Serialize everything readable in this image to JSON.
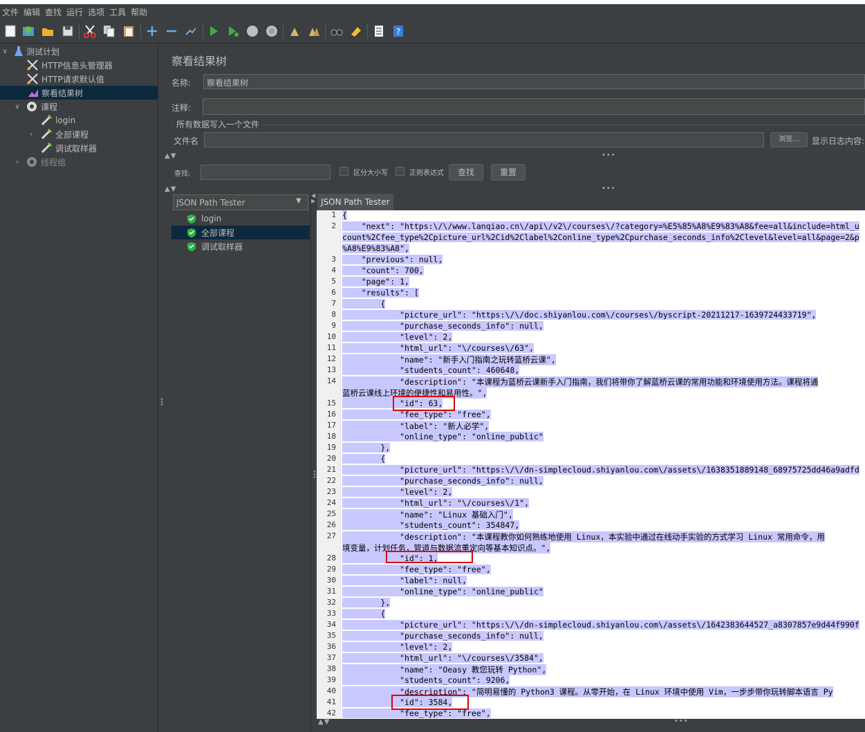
{
  "menu": [
    "文件",
    "编辑",
    "查找",
    "运行",
    "选项",
    "工具",
    "帮助"
  ],
  "toolbar": {
    "icons": [
      "new-icon",
      "templates-icon",
      "open-icon",
      "save-icon",
      "cut-icon",
      "copy-icon",
      "paste-icon",
      "expand-icon",
      "collapse-icon",
      "toggle-icon",
      "start-icon",
      "start-no-pause-icon",
      "stop-icon",
      "shutdown-icon",
      "clear-icon",
      "clear-all-icon",
      "search-icon",
      "reset-search-icon",
      "function-helper-icon",
      "help-icon"
    ]
  },
  "tree": {
    "items": [
      {
        "label": "测试计划",
        "icon": "test-plan-icon"
      },
      {
        "label": "HTTP信息头管理器",
        "icon": "config-element-icon"
      },
      {
        "label": "HTTP请求默认值",
        "icon": "config-element-icon"
      },
      {
        "label": "察看结果树",
        "icon": "listener-icon"
      },
      {
        "label": "课程",
        "icon": "thread-group-icon"
      },
      {
        "label": "login",
        "icon": "sampler-icon"
      },
      {
        "label": "全部课程",
        "icon": "sampler-icon"
      },
      {
        "label": "调试取样器",
        "icon": "sampler-icon"
      },
      {
        "label": "线程组",
        "icon": "thread-group-icon"
      }
    ]
  },
  "panel": {
    "title": "察看结果树",
    "name_label": "名称:",
    "name_value": "察看结果树",
    "comment_label": "注释:",
    "comment_value": "",
    "file_section": "所有数据写入一个文件",
    "filename_label": "文件名",
    "filename_value": "",
    "browse_label": "浏览...",
    "log_label": "显示日志内容:"
  },
  "search": {
    "label": "查找:",
    "value": "",
    "case_label": "区分大小写",
    "regex_label": "正则表达式",
    "find_button": "查找",
    "reset_button": "重置"
  },
  "renderer": {
    "selected": "JSON Path Tester",
    "samples": [
      "login",
      "全部课程",
      "调试取样器"
    ],
    "tab": "JSON Path Tester"
  },
  "code": {
    "lines": [
      {
        "n": "1",
        "t": "{"
      },
      {
        "n": "2",
        "t": "    \"next\": \"https:\\/\\/www.lanqiao.cn\\/api\\/v2\\/courses\\/?category=%E5%85%A8%E9%83%A8&fee=all&include=html_u"
      },
      {
        "n": "",
        "t": "count%2Cfee_type%2Cpicture_url%2Cid%2Clabel%2Conline_type%2Cpurchase_seconds_info%2Clevel&level=all&page=2&p"
      },
      {
        "n": "",
        "t": "%A8%E9%83%A8\","
      },
      {
        "n": "3",
        "t": "    \"previous\": null,"
      },
      {
        "n": "4",
        "t": "    \"count\": 700,"
      },
      {
        "n": "5",
        "t": "    \"page\": 1,"
      },
      {
        "n": "6",
        "t": "    \"results\": ["
      },
      {
        "n": "7",
        "t": "        {"
      },
      {
        "n": "8",
        "t": "            \"picture_url\": \"https:\\/\\/doc.shiyanlou.com\\/courses\\/byscript-20211217-1639724433719\","
      },
      {
        "n": "9",
        "t": "            \"purchase_seconds_info\": null,"
      },
      {
        "n": "10",
        "t": "            \"level\": 2,"
      },
      {
        "n": "11",
        "t": "            \"html_url\": \"\\/courses\\/63\","
      },
      {
        "n": "12",
        "t": "            \"name\": \"新手入门指南之玩转蓝桥云课\","
      },
      {
        "n": "13",
        "t": "            \"students_count\": 460648,"
      },
      {
        "n": "14",
        "t": "            \"description\": \"本课程为蓝桥云课新手入门指南，我们将带你了解蓝桥云课的常用功能和环境使用方法。课程将通"
      },
      {
        "n": "",
        "t": "蓝桥云课线上环境的便捷性和易用性。\","
      },
      {
        "n": "15",
        "t": "            \"id\": 63,"
      },
      {
        "n": "16",
        "t": "            \"fee_type\": \"free\","
      },
      {
        "n": "17",
        "t": "            \"label\": \"新人必学\","
      },
      {
        "n": "18",
        "t": "            \"online_type\": \"online_public\""
      },
      {
        "n": "19",
        "t": "        },"
      },
      {
        "n": "20",
        "t": "        {"
      },
      {
        "n": "21",
        "t": "            \"picture_url\": \"https:\\/\\/dn-simplecloud.shiyanlou.com\\/assets\\/1638351889148_68975725dd46a9adfd"
      },
      {
        "n": "22",
        "t": "            \"purchase_seconds_info\": null,"
      },
      {
        "n": "23",
        "t": "            \"level\": 2,"
      },
      {
        "n": "24",
        "t": "            \"html_url\": \"\\/courses\\/1\","
      },
      {
        "n": "25",
        "t": "            \"name\": \"Linux 基础入门\","
      },
      {
        "n": "26",
        "t": "            \"students_count\": 354847,"
      },
      {
        "n": "27",
        "t": "            \"description\": \"本课程教你如何熟练地使用 Linux，本实验中通过在线动手实验的方式学习 Linux 常用命令，用"
      },
      {
        "n": "",
        "t": "境变量，计划任务，管道与数据流重定向等基本知识点。\","
      },
      {
        "n": "28",
        "t": "            \"id\": 1,"
      },
      {
        "n": "29",
        "t": "            \"fee_type\": \"free\","
      },
      {
        "n": "30",
        "t": "            \"label\": null,"
      },
      {
        "n": "31",
        "t": "            \"online_type\": \"online_public\""
      },
      {
        "n": "32",
        "t": "        },"
      },
      {
        "n": "33",
        "t": "        {"
      },
      {
        "n": "34",
        "t": "            \"picture_url\": \"https:\\/\\/dn-simplecloud.shiyanlou.com\\/assets\\/1642383644527_a8307857e9d44f990f"
      },
      {
        "n": "35",
        "t": "            \"purchase_seconds_info\": null,"
      },
      {
        "n": "36",
        "t": "            \"level\": 2,"
      },
      {
        "n": "37",
        "t": "            \"html_url\": \"\\/courses\\/3584\","
      },
      {
        "n": "38",
        "t": "            \"name\": \"Oeasy 教您玩转 Python\","
      },
      {
        "n": "39",
        "t": "            \"students_count\": 9206,"
      },
      {
        "n": "40",
        "t": "            \"description\": \"简明易懂的 Python3 课程。从零开始，在 Linux 环境中使用 Vim，一步步带你玩转脚本语言 Py"
      },
      {
        "n": "41",
        "t": "            \"id\": 3584,"
      },
      {
        "n": "42",
        "t": "            \"fee_type\": \"free\","
      }
    ]
  }
}
